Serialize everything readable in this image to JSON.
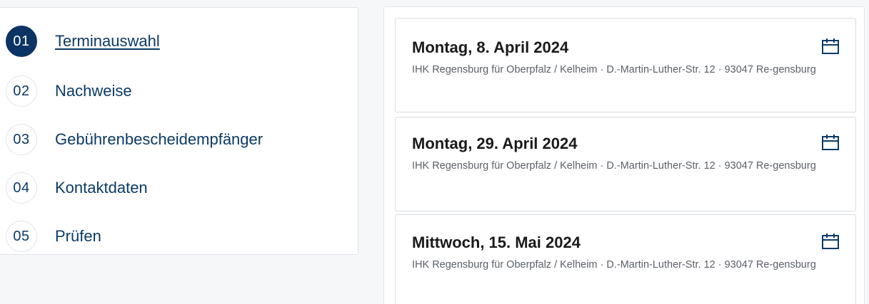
{
  "steps": [
    {
      "number": "01",
      "label": "Terminauswahl",
      "active": true
    },
    {
      "number": "02",
      "label": "Nachweise",
      "active": false
    },
    {
      "number": "03",
      "label": "Gebührenbescheidempfänger",
      "active": false
    },
    {
      "number": "04",
      "label": "Kontaktdaten",
      "active": false
    },
    {
      "number": "05",
      "label": "Prüfen",
      "active": false
    }
  ],
  "dates": [
    {
      "title": "Montag, 8. April 2024",
      "address": "IHK Regensburg für Oberpfalz / Kelheim · D.-Martin-Luther-Str. 12 · 93047 Re-gensburg",
      "icon": "calendar-icon"
    },
    {
      "title": "Montag, 29. April 2024",
      "address": "IHK Regensburg für Oberpfalz / Kelheim · D.-Martin-Luther-Str. 12 · 93047 Re-gensburg",
      "icon": "calendar-icon"
    },
    {
      "title": "Mittwoch, 15. Mai 2024",
      "address": "IHK Regensburg für Oberpfalz / Kelheim · D.-Martin-Luther-Str. 12 · 93047 Re-gensburg",
      "icon": "calendar-icon"
    }
  ],
  "colors": {
    "primary": "#0b3464",
    "link": "#0b3a66",
    "text": "#1a1a1a",
    "muted": "#5b6168",
    "border": "#dfe3e8"
  }
}
